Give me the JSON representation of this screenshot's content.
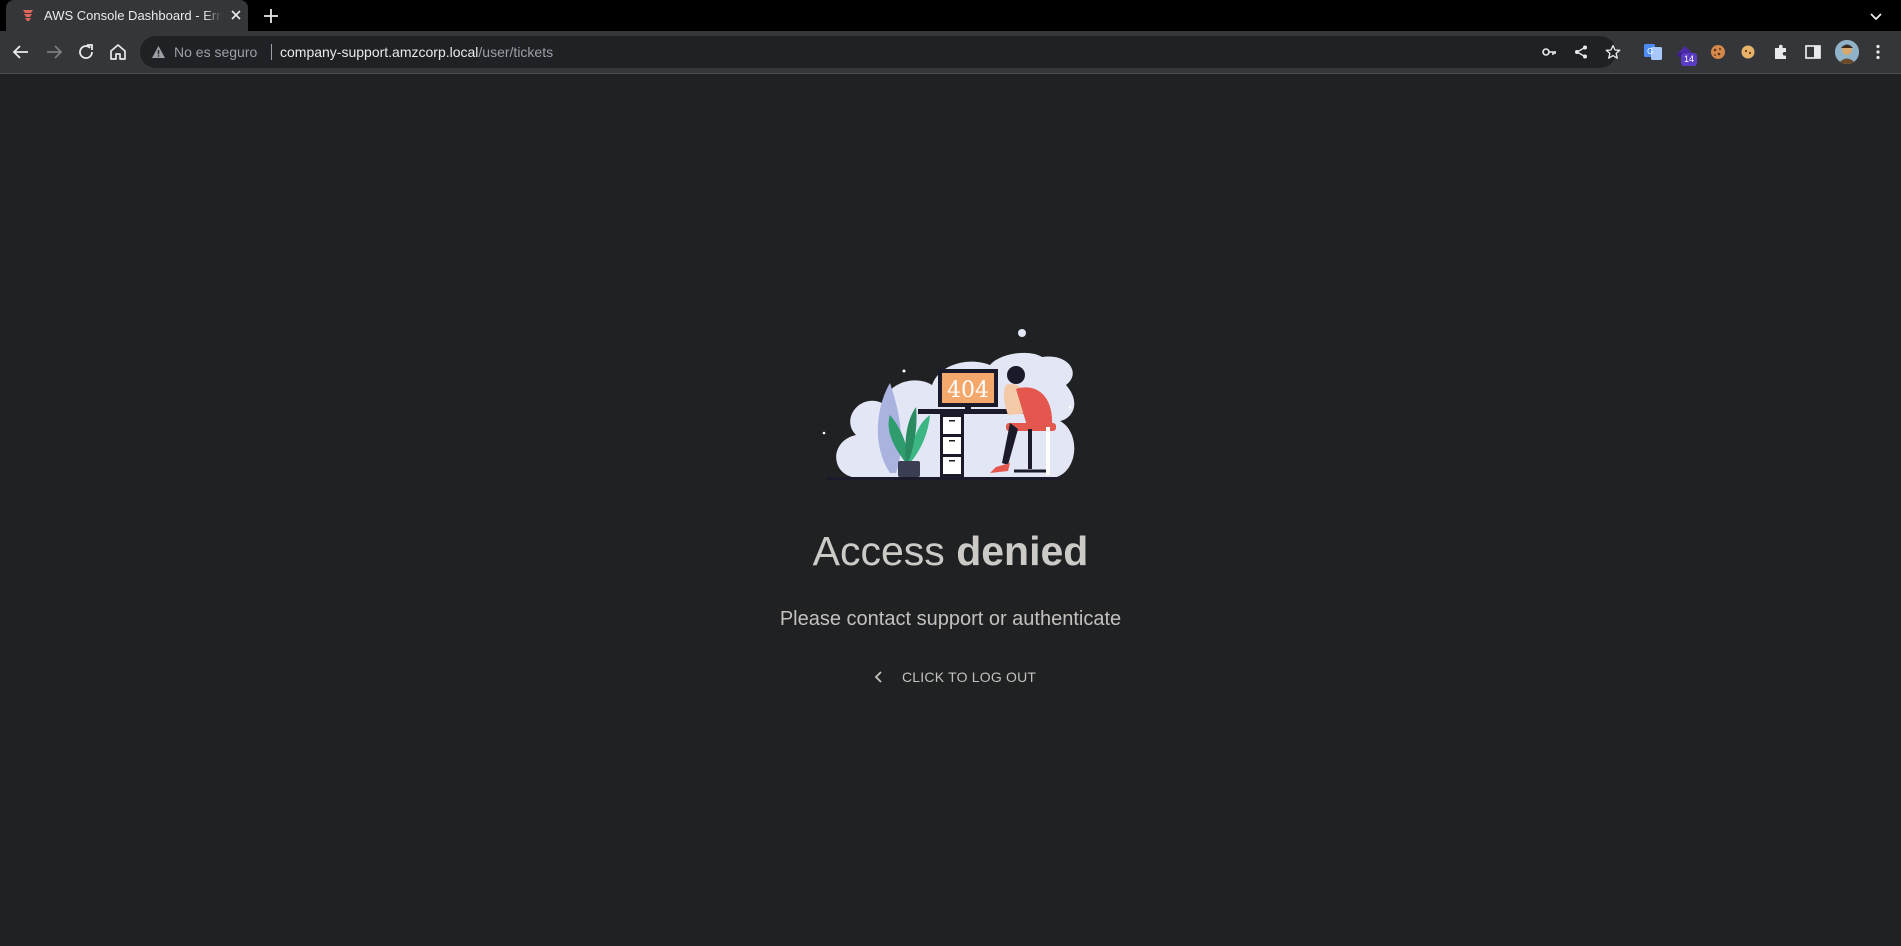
{
  "browser": {
    "tab": {
      "title": "AWS Console Dashboard - Error",
      "favicon": "layers-favicon-icon"
    },
    "omnibox": {
      "security_label": "No es seguro",
      "url_host": "company-support.amzcorp.local",
      "url_path": "/user/tickets"
    },
    "extensions": {
      "badge_count": "14"
    },
    "icons": [
      "back-icon",
      "forward-icon",
      "reload-icon",
      "home-icon",
      "key-icon",
      "share-icon",
      "star-icon",
      "translate-icon",
      "cookie-icon",
      "puzzle-icon",
      "sidepanel-icon",
      "menu-icon"
    ]
  },
  "page": {
    "illustration": {
      "screen_text": "404"
    },
    "heading_light": "Access",
    "heading_bold": "denied",
    "subtitle": "Please contact support or authenticate",
    "logout_label": "CLICK TO LOG OUT"
  },
  "colors": {
    "page_bg": "#1f2122",
    "toolbar_bg": "#35363a",
    "tab_strip_bg": "#000000",
    "text_primary": "#cccac6",
    "accent_orange": "#f4a86b",
    "accent_red": "#e4574f"
  }
}
